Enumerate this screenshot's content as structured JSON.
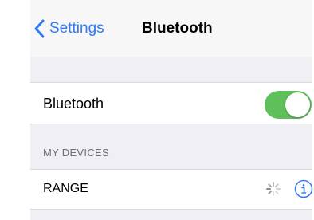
{
  "navbar": {
    "back_label": "Settings",
    "title": "Bluetooth",
    "back_icon": "chevron-left-icon",
    "accent_color": "#2f7bf6"
  },
  "bluetooth_row": {
    "label": "Bluetooth",
    "toggle_on": true,
    "toggle_color": "#5fc05b"
  },
  "my_devices": {
    "header": "MY DEVICES",
    "devices": [
      {
        "name": "RANGE",
        "status_icon": "loading-spinner-icon",
        "info_icon": "info-icon"
      }
    ]
  }
}
